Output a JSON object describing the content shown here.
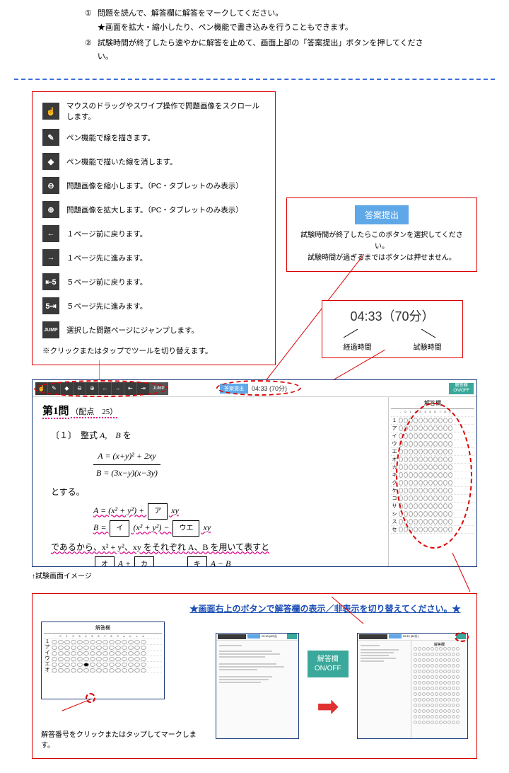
{
  "instructions": {
    "num1": "①",
    "text1a": "問題を読んで、解答欄に解答をマークしてください。",
    "text1b": "★画面を拡大・縮小したり、ペン機能で書き込みを行うこともできます。",
    "num2": "②",
    "text2": "試験時間が終了したら速やかに解答を止めて、画面上部の「答案提出」ボタンを押してください。"
  },
  "tools": {
    "hand": "マウスのドラッグやスワイプ操作で問題画像をスクロールします。",
    "pen": "ペン機能で線を描きます。",
    "eraser": "ペン機能で描いた線を消します。",
    "zoomout": "問題画像を縮小します。（PC・タブレットのみ表示）",
    "zoomin": "問題画像を拡大します。（PC・タブレットのみ表示）",
    "back1": "１ページ前に戻ります。",
    "fwd1": "１ページ先に進みます。",
    "back5": "５ページ前に戻ります。",
    "fwd5": "５ページ先に進みます。",
    "jump": "選択した問題ページにジャンプします。",
    "note": "※クリックまたはタップでツールを切り替えます。",
    "jump_label": "JUMP"
  },
  "submit": {
    "button": "答案提出",
    "line1": "試験時間が終了したらこのボタンを選択してください。",
    "line2": "試験時間が過ぎるまではボタンは押せません。"
  },
  "timer": {
    "display": "04:33（70分）",
    "elapsed_label": "経過時間",
    "total_label": "試験時間"
  },
  "screenshot": {
    "timer_text": "04:33 (70分)",
    "submit_text": "答案提出",
    "onoff_text": "解答欄\nON/OFF",
    "q_title": "第1問",
    "q_score": "（配点　25）",
    "q_intro_prefix": "〔１〕　整式",
    "q_intro_ab": "A,　B",
    "q_intro_suffix": "を",
    "eq_a": "A = (x+y)² + 2xy",
    "eq_b": "B = (3x−y)(x−3y)",
    "tosuru": "とする。",
    "eq_a2_pre": "A = (x² + y²) + ",
    "box_a": "ア",
    "eq_a2_post": " xy",
    "eq_b2_pre": "B = ",
    "box_i": "イ",
    "eq_b2_mid": " (x² + y²) − ",
    "box_ue": "ウエ",
    "eq_b2_post": " xy",
    "dearu": "であるから、x² + y²、xy をそれぞれ A、B を用いて表すと",
    "box_o": "オ",
    "plus_a": " A + ",
    "box_ka": "カ",
    "box_ki": "キ",
    "minus_ab": " A − B",
    "answer_header": "解答欄",
    "col_header": "- 0 1 2 3 4 5 6 7 8 9",
    "row_labels": [
      "1",
      "ア",
      "イ",
      "ウ",
      "エ",
      "オ",
      "カ",
      "キ",
      "ク",
      "ケ",
      "コ",
      "サ",
      "シ",
      "ス",
      "セ"
    ],
    "caption": "↑試験画面イメージ"
  },
  "bottom": {
    "title": "★画面右上のボタンで解答欄の表示／非表示を切り替えてください。★",
    "onoff": "解答欄\nON/OFF",
    "arrow": "➡",
    "caption": "解答番号をクリックまたはタップしてマークします。",
    "mini_header": "解答欄",
    "mini_cols": "- 0 1 2 3 4 5 6 7 8 9 a b c d",
    "mini_cols2": "- 0 1 2 3 4 5 6 7 8 9",
    "mini_rows": [
      "1",
      "ア",
      "イ",
      "ウ",
      "エ",
      "オ"
    ],
    "mini_timer": "29:33 (80分)"
  }
}
